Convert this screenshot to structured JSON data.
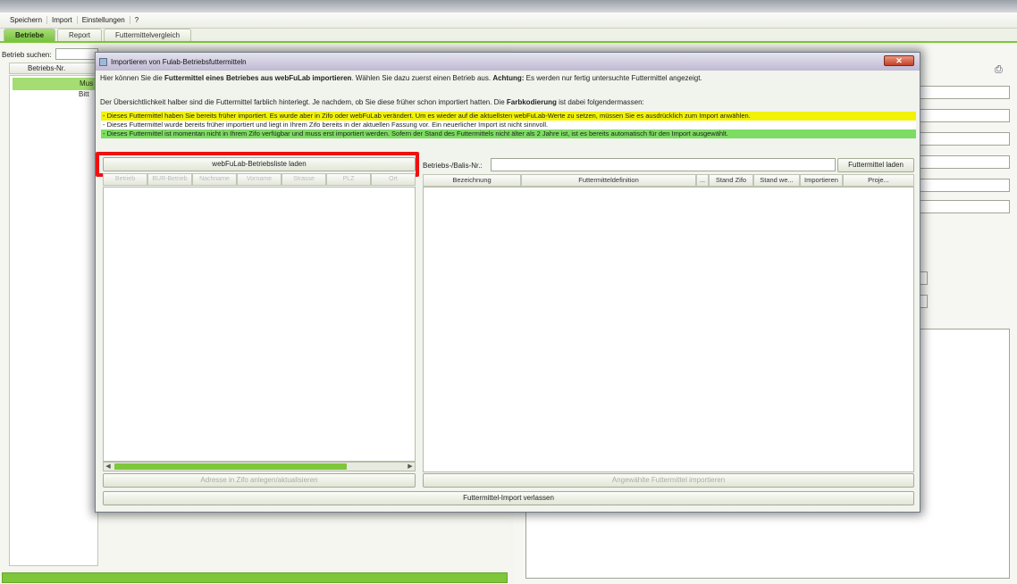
{
  "menu": [
    "Speichern",
    "Import",
    "Einstellungen",
    "?"
  ],
  "tabs": [
    "Betriebe",
    "Report",
    "Futtermittelvergleich"
  ],
  "background": {
    "search_label": "Betrieb suchen:",
    "column_header": "Betriebs-Nr.",
    "row_selected": "Mus",
    "row_second": "Bitt"
  },
  "dialog": {
    "title": "Importieren von Fulab-Betriebsfuttermitteln",
    "info1": {
      "prefix": "Hier können Sie die ",
      "bold1": "Futtermittel eines Betriebes aus webFuLab importieren",
      "mid": ". Wählen Sie dazu zuerst einen Betrieb aus. ",
      "bold2": "Achtung:",
      "suffix": " Es werden nur fertig untersuchte Futtermittel angezeigt."
    },
    "info2": {
      "prefix": "Der Übersichtlichkeit halber sind die Futtermittel farblich hinterlegt. Je nachdem, ob Sie diese früher schon importiert hatten. Die ",
      "bold": "Farbkodierung",
      "suffix": " ist dabei folgendermassen:"
    },
    "legend_yellow": "- Dieses Futtermittel haben Sie bereits früher importiert. Es wurde aber in Zifo oder webFuLab verändert. Um es wieder auf die aktuellsten webFuLab-Werte zu setzen, müssen Sie es ausdrücklich zum Import anwählen.",
    "legend_white": "- Dieses Futtermittel wurde bereits früher importiert und liegt in Ihrem Zifo bereits in der aktuellen Fassung vor. Ein neuerlicher Import ist nicht sinnvoll.",
    "legend_green": "- Dieses Futtermittel ist momentan nicht in Ihrem Zifo verfügbar und muss erst importiert werden. Sofern der Stand des Futtermittels nicht älter als 2 Jahre ist, ist es bereits automatisch für den Import ausgewählt.",
    "load_list_button": "webFuLab-Betriebsliste laden",
    "left_table_headers": [
      "Betrieb",
      "BUR-Betrieb",
      "Nachname",
      "Vorname",
      "Strasse",
      "PLZ",
      "Ort"
    ],
    "address_button": "Adresse in Zifo anlegen/aktualisieren",
    "betrieb_label": "Betriebs-/Balis-Nr.:",
    "load_futtermittel_button": "Futtermittel laden",
    "right_table_headers": [
      "Bezeichnung",
      "Futtermitteldefinition",
      "...",
      "Stand Zifo",
      "Stand we...",
      "Importieren",
      "Proje..."
    ],
    "import_selected_button": "Angewählte Futtermittel importieren",
    "leave_button": "Futtermittel-Import verlassen"
  }
}
